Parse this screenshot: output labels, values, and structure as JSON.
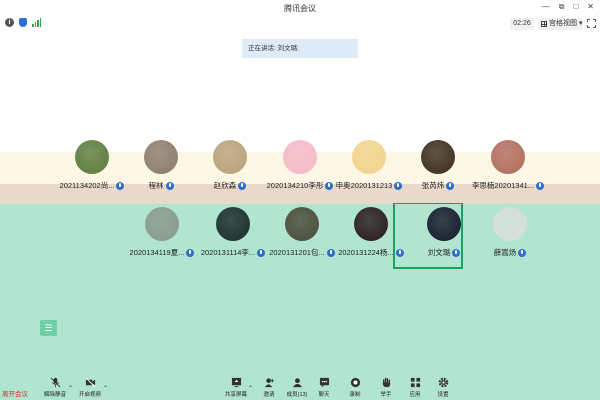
{
  "window": {
    "title": "腾讯会议",
    "controls": [
      "—",
      "⧉",
      "□",
      "✕"
    ]
  },
  "toolbar": {
    "timer": "02:26",
    "gallery_label": "宫格视图",
    "gallery_caret": "▾"
  },
  "speaker_banner": "正在讲话: 刘文璐;",
  "participants_row1": [
    {
      "name": "2021134202尚...",
      "color": "#5a7a3a"
    },
    {
      "name": "程林",
      "color": "#8a7a6a"
    },
    {
      "name": "赵欣森",
      "color": "#b8a07a"
    },
    {
      "name": "2020134210李彤",
      "color": "#f4b8c8"
    },
    {
      "name": "申奥2020131213",
      "color": "#f2d28a"
    },
    {
      "name": "张芮炜",
      "color": "#3a2a1a"
    },
    {
      "name": "李思楠20201341...",
      "color": "#b06a5a"
    }
  ],
  "participants_row2": [
    {
      "name": "2020134119夏...",
      "color": "#8a9a8a"
    },
    {
      "name": "2020131114李...",
      "color": "#1a2a2a"
    },
    {
      "name": "2020131201包...",
      "color": "#4a4a3a"
    },
    {
      "name": "2020131224杨...",
      "color": "#2a1a1a"
    },
    {
      "name": "刘文璐",
      "color": "#151a2a"
    },
    {
      "name": "薛嵩炀",
      "color": "#d8e0d8"
    }
  ],
  "side_handle": "☰",
  "bottom_bar": {
    "mute": "解除静音",
    "video": "开启视频",
    "share": "共享屏幕",
    "invite": "邀请",
    "members": "成员(13)",
    "chat": "聊天",
    "record": "录制",
    "raise_hand": "举手",
    "apps": "应用",
    "settings": "设置",
    "caret": "⌃"
  },
  "leave_label": "离开会议",
  "colors": {
    "accent_blue": "#2f6fc9",
    "speaking_green": "#1e9f63",
    "band_top": "#fdf7e5",
    "band_mid": "#e9d9cb",
    "band_green": "#b2e5d0"
  }
}
